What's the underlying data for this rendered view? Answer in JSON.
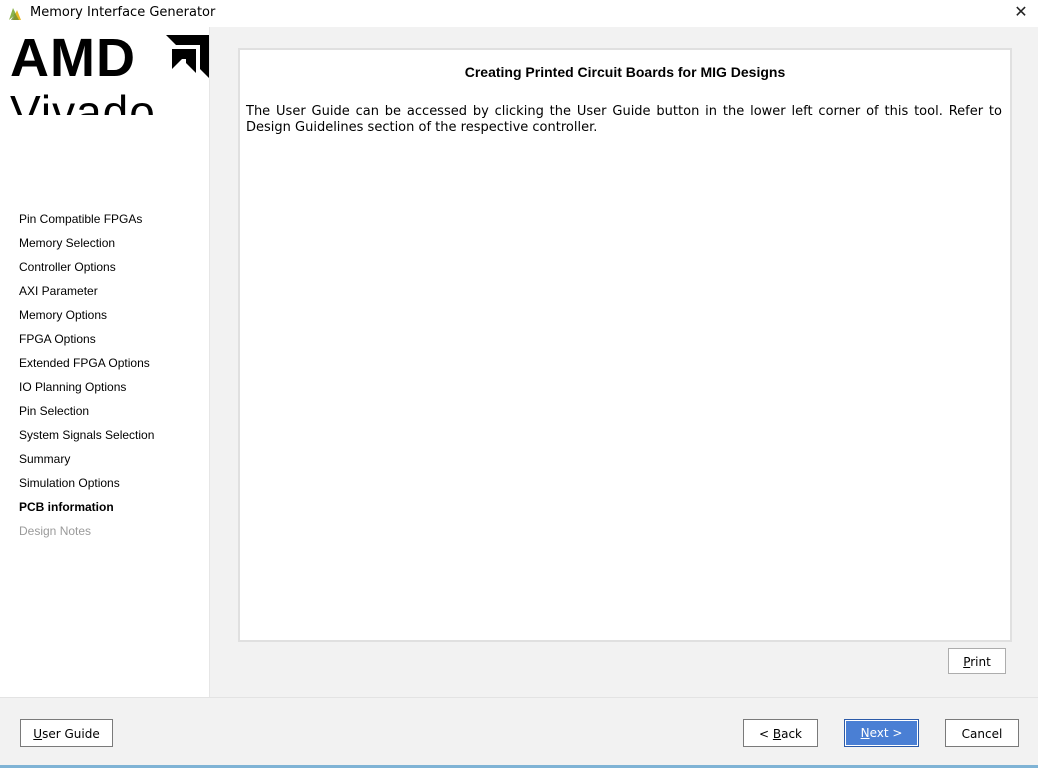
{
  "window": {
    "title": "Memory Interface Generator",
    "close_glyph": "✕"
  },
  "logo": {
    "brand": "AMD",
    "product": "Vivado"
  },
  "nav": {
    "items": [
      {
        "label": "Pin Compatible FPGAs",
        "state": "normal"
      },
      {
        "label": "Memory Selection",
        "state": "normal"
      },
      {
        "label": "Controller Options",
        "state": "normal"
      },
      {
        "label": "AXI Parameter",
        "state": "normal"
      },
      {
        "label": "Memory Options",
        "state": "normal"
      },
      {
        "label": "FPGA Options",
        "state": "normal"
      },
      {
        "label": "Extended FPGA Options",
        "state": "normal"
      },
      {
        "label": "IO Planning Options",
        "state": "normal"
      },
      {
        "label": "Pin Selection",
        "state": "normal"
      },
      {
        "label": "System Signals Selection",
        "state": "normal"
      },
      {
        "label": "Summary",
        "state": "normal"
      },
      {
        "label": "Simulation Options",
        "state": "normal"
      },
      {
        "label": "PCB information",
        "state": "active"
      },
      {
        "label": "Design Notes",
        "state": "disabled"
      }
    ]
  },
  "content": {
    "title": "Creating Printed Circuit Boards for MIG Designs",
    "body": "The User Guide can be accessed by clicking the User Guide button in the lower left corner of this tool. Refer to Design Guidelines section of the respective controller."
  },
  "buttons": {
    "print_mnemonic": "P",
    "print_rest": "rint",
    "guide_mnemonic": "U",
    "guide_rest": "ser Guide",
    "back_prefix": "< ",
    "back_mnemonic": "B",
    "back_rest": "ack",
    "next_mnemonic": "N",
    "next_rest": "ext >",
    "cancel": "Cancel"
  },
  "colors": {
    "accent_button": "#4a7fd4",
    "logo_green": "#8ab34a",
    "logo_yellow": "#e8b923"
  },
  "icons": {
    "title": "vivado-app-icon",
    "close": "close-icon"
  }
}
